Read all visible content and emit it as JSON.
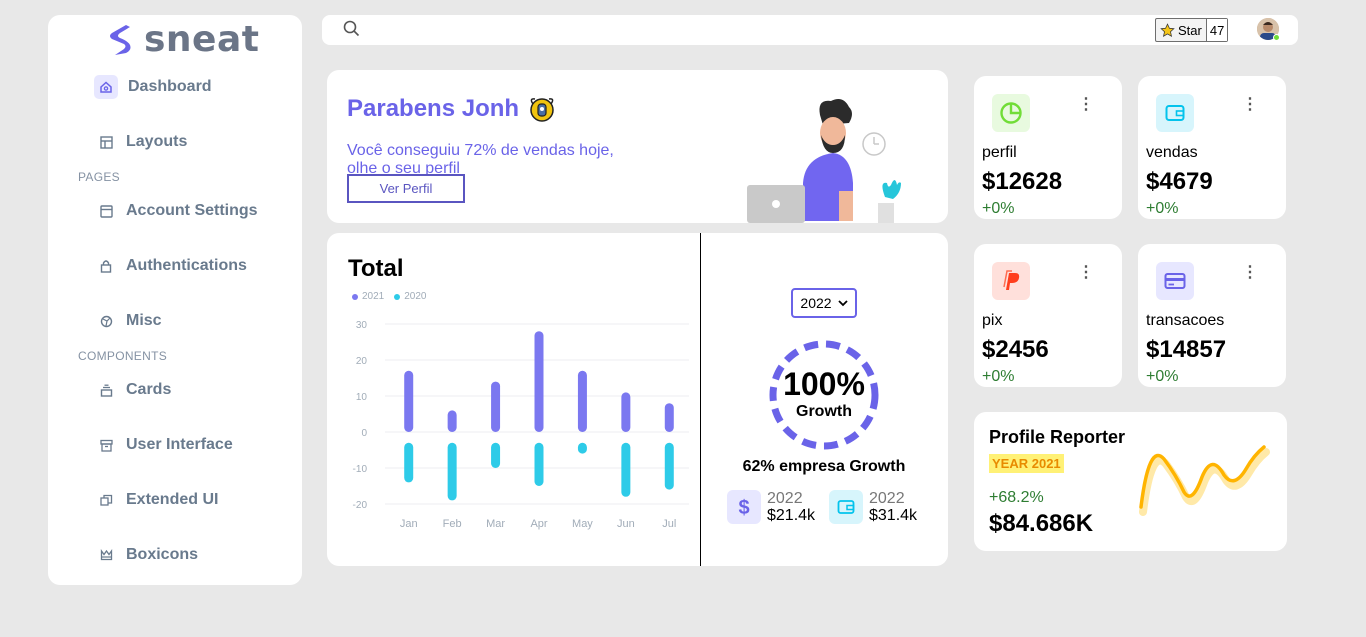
{
  "brand": {
    "name": "sneat"
  },
  "sidebar": {
    "items": [
      {
        "label": "Dashboard",
        "icon": "home-icon"
      },
      {
        "label": "Layouts",
        "icon": "layout-icon"
      },
      {
        "label": "Account Settings",
        "icon": "window-icon"
      },
      {
        "label": "Authentications",
        "icon": "lock-icon"
      },
      {
        "label": "Misc",
        "icon": "cube-icon"
      },
      {
        "label": "Cards",
        "icon": "collection-icon"
      },
      {
        "label": "User Interface",
        "icon": "box-icon"
      },
      {
        "label": "Extended UI",
        "icon": "copy-icon"
      },
      {
        "label": "Boxicons",
        "icon": "crown-icon"
      }
    ],
    "sections": {
      "pages": "PAGES",
      "components": "COMPONENTS"
    }
  },
  "topbar": {
    "star_label": "Star",
    "star_count": "47"
  },
  "welcome": {
    "title": "Parabens Jonh",
    "message": "Você conseguiu 72% de vendas hoje, olhe o seu perfil",
    "button": "Ver Perfil"
  },
  "total": {
    "title": "Total",
    "legend": [
      "2021",
      "2020"
    ],
    "year_select": "2022",
    "growth_pct": "100%",
    "growth_label": "Growth",
    "company_growth": "62% empresa Growth",
    "mini": [
      {
        "year": "2022",
        "amount": "$21.4k",
        "icon": "dollar-icon"
      },
      {
        "year": "2022",
        "amount": "$31.4k",
        "icon": "wallet-icon"
      }
    ]
  },
  "chart_data": {
    "type": "bar",
    "categories": [
      "Jan",
      "Feb",
      "Mar",
      "Apr",
      "May",
      "Jun",
      "Jul"
    ],
    "series": [
      {
        "name": "2021",
        "values": [
          17,
          6,
          14,
          28,
          17,
          11,
          8
        ],
        "base": 0
      },
      {
        "name": "2020",
        "values": [
          -14,
          -19,
          -10,
          -15,
          -6,
          -18,
          -16
        ],
        "base": -3
      }
    ],
    "yticks": [
      30,
      20,
      10,
      0,
      -10,
      -20
    ],
    "ylim": [
      -20,
      30
    ],
    "colors": {
      "2021": "#7b78f0",
      "2020": "#2ecbe8"
    }
  },
  "stats": [
    {
      "name": "perfil",
      "value": "$12628",
      "change": "+0%",
      "icon": "pie-chart-icon"
    },
    {
      "name": "vendas",
      "value": "$4679",
      "change": "+0%",
      "icon": "wallet-icon"
    },
    {
      "name": "pix",
      "value": "$2456",
      "change": "+0%",
      "icon": "paypal-icon"
    },
    {
      "name": "transacoes",
      "value": "$14857",
      "change": "+0%",
      "icon": "credit-card-icon"
    }
  ],
  "reporter": {
    "title": "Profile Reporter",
    "badge": "YEAR 2021",
    "change": "+68.2%",
    "amount": "$84.686K"
  }
}
